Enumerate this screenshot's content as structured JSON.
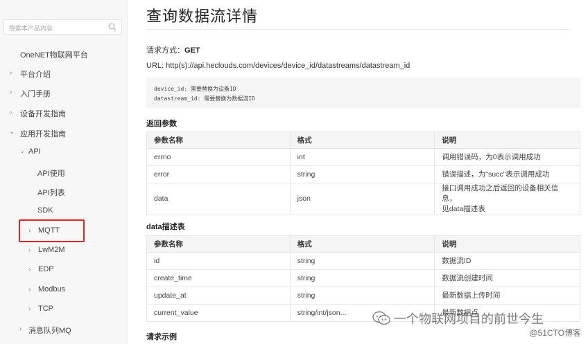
{
  "sidebar": {
    "search_placeholder": "搜索本产品内容",
    "top_item": "OneNET物联网平台",
    "items": [
      {
        "label": "平台介绍"
      },
      {
        "label": "入门手册"
      },
      {
        "label": "设备开发指南"
      },
      {
        "label": "应用开发指南"
      },
      {
        "label": "API"
      },
      {
        "label": "API使用"
      },
      {
        "label": "API列表"
      },
      {
        "label": "SDK"
      },
      {
        "label": "MQTT"
      },
      {
        "label": "LwM2M"
      },
      {
        "label": "EDP"
      },
      {
        "label": "Modbus"
      },
      {
        "label": "TCP"
      },
      {
        "label": "消息队列MQ"
      }
    ]
  },
  "main": {
    "title": "查询数据流详情",
    "request_label": "请求方式：",
    "request_method": "GET",
    "url": "URL: http(s)://api.heclouds.com/devices/device_id/datastreams/datastream_id",
    "code_lines": [
      "device_id: 需要替换为设备ID",
      "datastream_id: 需要替换为数据流ID"
    ],
    "return_section": {
      "title": "返回参数",
      "headers": [
        "参数名称",
        "格式",
        "说明"
      ],
      "rows": [
        [
          "errno",
          "int",
          "调用错误码，为0表示调用成功"
        ],
        [
          "error",
          "string",
          "错误描述，为\"succ\"表示调用成功"
        ],
        [
          "data",
          "json",
          "接口调用成功之后返回的设备相关信息，",
          "见data描述表"
        ]
      ]
    },
    "data_section": {
      "title": "data描述表",
      "headers": [
        "参数名称",
        "格式",
        "说明"
      ],
      "rows": [
        [
          "id",
          "string",
          "数据流ID"
        ],
        [
          "create_time",
          "string",
          "数据流创建时间"
        ],
        [
          "update_at",
          "string",
          "最新数据上传时间"
        ],
        [
          "current_value",
          "string/int/json...",
          "最新数据点"
        ]
      ]
    },
    "example_title": "请求示例"
  },
  "watermark": {
    "text": "一个物联网项目的前世今生",
    "sub": "@51CTO博客"
  }
}
